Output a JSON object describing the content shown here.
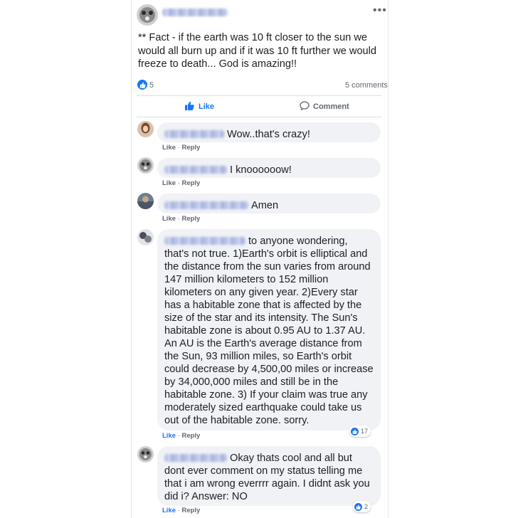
{
  "post": {
    "text": "** Fact - if the earth was 10 ft closer to the sun we would all burn up and if it was 10 ft further we would freeze to death... God is amazing!!",
    "reaction_count": "5",
    "comments_count": "5 comments",
    "more_label": "•••"
  },
  "actions": {
    "like_label": "Like",
    "comment_label": "Comment"
  },
  "comments": [
    {
      "text": "Wow..that's crazy!",
      "like": "Like",
      "reply": "Reply",
      "sep": " · "
    },
    {
      "text": "I knoooooow!",
      "like": "Like",
      "reply": "Reply",
      "sep": " · "
    },
    {
      "text": "Amen",
      "like": "Like",
      "reply": "Reply",
      "sep": " · "
    },
    {
      "text": "to anyone wondering, that's not true. 1)Earth's orbit is elliptical and the distance from the sun varies from around 147 million kilometers to 152 million kilometers on any given year. 2)Every star has a habitable zone that is affected by the size of the star and its intensity. The Sun's habitable zone is about 0.95 AU to 1.37 AU. An AU is the Earth's average distance from the Sun, 93 million miles, so Earth's orbit could decrease by 4,500,00 miles or increase by 34,000,000 miles and still be in the habitable zone. 3) If your claim was true any moderately sized earthquake could take us out of the habitable zone. sorry.",
      "like": "Like",
      "reply": "Reply",
      "sep": " · ",
      "reactions": "17"
    },
    {
      "text": "Okay thats cool and all but dont ever comment on my status telling me that i am wrong everrrr again. I didnt ask you did i? Answer: NO",
      "like": "Like",
      "reply": "Reply",
      "sep": " · ",
      "reactions": "2"
    }
  ],
  "colors": {
    "accent": "#1877f2",
    "bubble": "#f0f2f5",
    "meta": "#606770"
  }
}
